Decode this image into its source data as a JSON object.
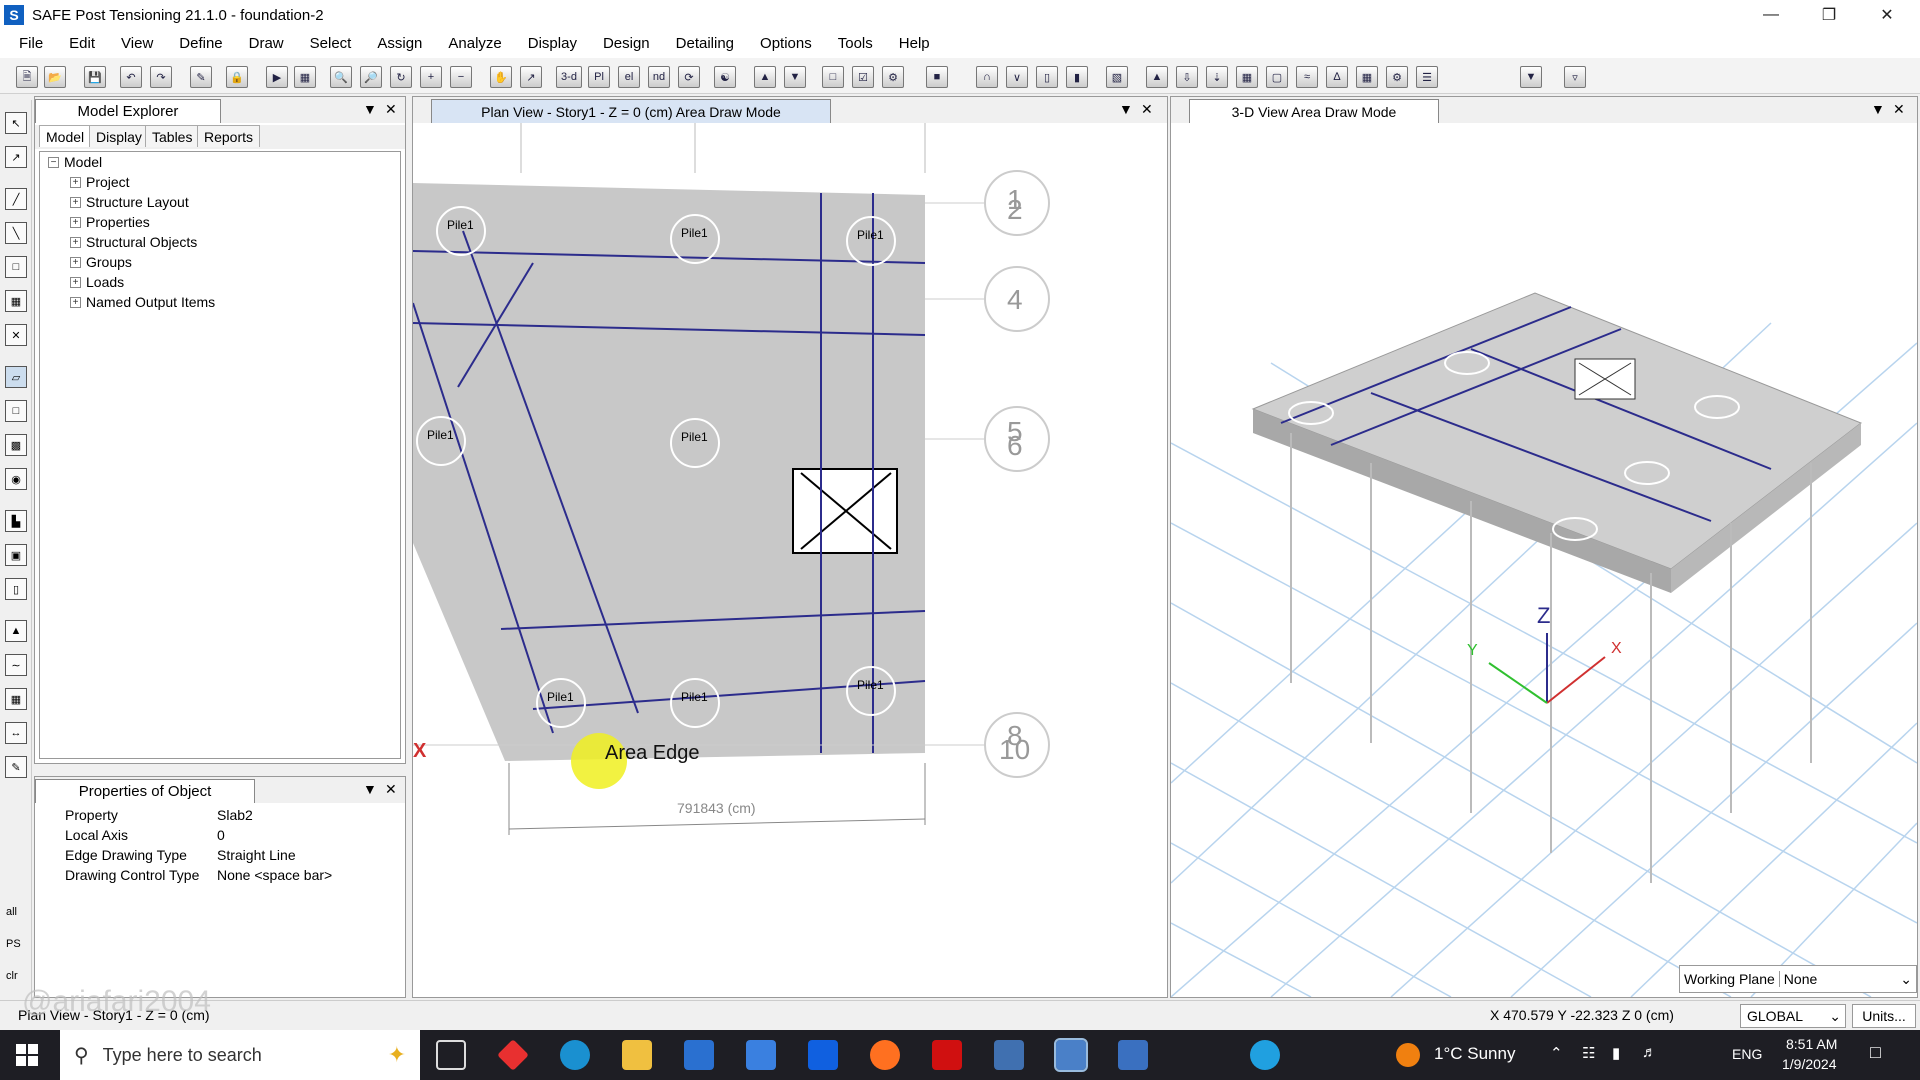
{
  "window": {
    "title": "SAFE Post Tensioning 21.1.0 - foundation-2",
    "app_letter": "S"
  },
  "menu": [
    "File",
    "Edit",
    "View",
    "Define",
    "Draw",
    "Select",
    "Assign",
    "Analyze",
    "Display",
    "Design",
    "Detailing",
    "Options",
    "Tools",
    "Help"
  ],
  "toolbar": {
    "three_d": "3-d",
    "pl": "Pl",
    "el": "el",
    "nd": "nd"
  },
  "model_explorer": {
    "title": "Model Explorer",
    "tabs": [
      "Model",
      "Display",
      "Tables",
      "Reports"
    ],
    "root": "Model",
    "items": [
      "Project",
      "Structure Layout",
      "Properties",
      "Structural Objects",
      "Groups",
      "Loads",
      "Named Output Items"
    ]
  },
  "properties_panel": {
    "title": "Properties of Object",
    "rows": [
      {
        "label": "Property",
        "value": "Slab2"
      },
      {
        "label": "Local Axis",
        "value": "0"
      },
      {
        "label": "Edge Drawing Type",
        "value": "Straight Line"
      },
      {
        "label": "Drawing Control Type",
        "value": "None  <space bar>"
      }
    ]
  },
  "plan_view": {
    "title": "Plan View - Story1 - Z = 0 (cm)  Area Draw Mode",
    "pile_label": "Pile1",
    "grid_labels": [
      "1",
      "2",
      "4",
      "5",
      "6",
      "8",
      "10"
    ],
    "tooltip": "Area Edge",
    "dimension": "791843 (cm)",
    "axis_marker": "X"
  },
  "view3d": {
    "title": "3-D View  Area Draw Mode",
    "axis_z": "Z",
    "axis_x": "X",
    "axis_y": "Y"
  },
  "working_plane": {
    "label": "Working Plane",
    "value": "None"
  },
  "statusbar": {
    "left": "Plan View - Story1 - Z = 0 (cm)",
    "coords": "X 470.579  Y -22.323  Z 0 (cm)",
    "coord_system": "GLOBAL",
    "units_button": "Units...",
    "watermark": "@ariafari2004"
  },
  "left_toolbar_labels": {
    "all": "all",
    "ps": "PS",
    "clr": "clr"
  },
  "taskbar": {
    "search_placeholder": "Type here to search",
    "weather": "1°C  Sunny",
    "lang": "ENG",
    "time": "8:51 AM",
    "date": "1/9/2024"
  },
  "colors": {
    "accent": "#1060c0",
    "slab": "#c8c8c8",
    "gridline": "#2c2c8c",
    "tooltip_dot": "#f0f020"
  }
}
